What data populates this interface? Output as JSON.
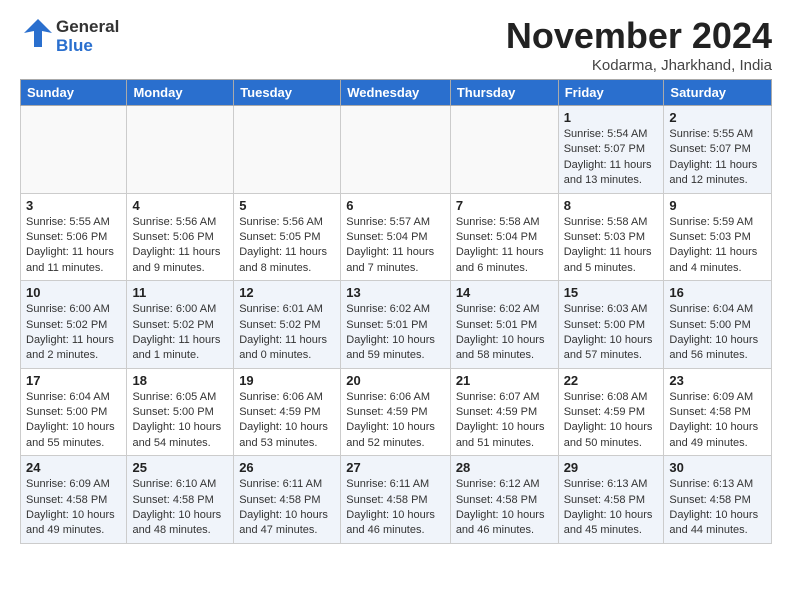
{
  "header": {
    "logo_general": "General",
    "logo_blue": "Blue",
    "month_title": "November 2024",
    "location": "Kodarma, Jharkhand, India"
  },
  "weekdays": [
    "Sunday",
    "Monday",
    "Tuesday",
    "Wednesday",
    "Thursday",
    "Friday",
    "Saturday"
  ],
  "weeks": [
    [
      {
        "day": "",
        "info": ""
      },
      {
        "day": "",
        "info": ""
      },
      {
        "day": "",
        "info": ""
      },
      {
        "day": "",
        "info": ""
      },
      {
        "day": "",
        "info": ""
      },
      {
        "day": "1",
        "info": "Sunrise: 5:54 AM\nSunset: 5:07 PM\nDaylight: 11 hours\nand 13 minutes."
      },
      {
        "day": "2",
        "info": "Sunrise: 5:55 AM\nSunset: 5:07 PM\nDaylight: 11 hours\nand 12 minutes."
      }
    ],
    [
      {
        "day": "3",
        "info": "Sunrise: 5:55 AM\nSunset: 5:06 PM\nDaylight: 11 hours\nand 11 minutes."
      },
      {
        "day": "4",
        "info": "Sunrise: 5:56 AM\nSunset: 5:06 PM\nDaylight: 11 hours\nand 9 minutes."
      },
      {
        "day": "5",
        "info": "Sunrise: 5:56 AM\nSunset: 5:05 PM\nDaylight: 11 hours\nand 8 minutes."
      },
      {
        "day": "6",
        "info": "Sunrise: 5:57 AM\nSunset: 5:04 PM\nDaylight: 11 hours\nand 7 minutes."
      },
      {
        "day": "7",
        "info": "Sunrise: 5:58 AM\nSunset: 5:04 PM\nDaylight: 11 hours\nand 6 minutes."
      },
      {
        "day": "8",
        "info": "Sunrise: 5:58 AM\nSunset: 5:03 PM\nDaylight: 11 hours\nand 5 minutes."
      },
      {
        "day": "9",
        "info": "Sunrise: 5:59 AM\nSunset: 5:03 PM\nDaylight: 11 hours\nand 4 minutes."
      }
    ],
    [
      {
        "day": "10",
        "info": "Sunrise: 6:00 AM\nSunset: 5:02 PM\nDaylight: 11 hours\nand 2 minutes."
      },
      {
        "day": "11",
        "info": "Sunrise: 6:00 AM\nSunset: 5:02 PM\nDaylight: 11 hours\nand 1 minute."
      },
      {
        "day": "12",
        "info": "Sunrise: 6:01 AM\nSunset: 5:02 PM\nDaylight: 11 hours\nand 0 minutes."
      },
      {
        "day": "13",
        "info": "Sunrise: 6:02 AM\nSunset: 5:01 PM\nDaylight: 10 hours\nand 59 minutes."
      },
      {
        "day": "14",
        "info": "Sunrise: 6:02 AM\nSunset: 5:01 PM\nDaylight: 10 hours\nand 58 minutes."
      },
      {
        "day": "15",
        "info": "Sunrise: 6:03 AM\nSunset: 5:00 PM\nDaylight: 10 hours\nand 57 minutes."
      },
      {
        "day": "16",
        "info": "Sunrise: 6:04 AM\nSunset: 5:00 PM\nDaylight: 10 hours\nand 56 minutes."
      }
    ],
    [
      {
        "day": "17",
        "info": "Sunrise: 6:04 AM\nSunset: 5:00 PM\nDaylight: 10 hours\nand 55 minutes."
      },
      {
        "day": "18",
        "info": "Sunrise: 6:05 AM\nSunset: 5:00 PM\nDaylight: 10 hours\nand 54 minutes."
      },
      {
        "day": "19",
        "info": "Sunrise: 6:06 AM\nSunset: 4:59 PM\nDaylight: 10 hours\nand 53 minutes."
      },
      {
        "day": "20",
        "info": "Sunrise: 6:06 AM\nSunset: 4:59 PM\nDaylight: 10 hours\nand 52 minutes."
      },
      {
        "day": "21",
        "info": "Sunrise: 6:07 AM\nSunset: 4:59 PM\nDaylight: 10 hours\nand 51 minutes."
      },
      {
        "day": "22",
        "info": "Sunrise: 6:08 AM\nSunset: 4:59 PM\nDaylight: 10 hours\nand 50 minutes."
      },
      {
        "day": "23",
        "info": "Sunrise: 6:09 AM\nSunset: 4:58 PM\nDaylight: 10 hours\nand 49 minutes."
      }
    ],
    [
      {
        "day": "24",
        "info": "Sunrise: 6:09 AM\nSunset: 4:58 PM\nDaylight: 10 hours\nand 49 minutes."
      },
      {
        "day": "25",
        "info": "Sunrise: 6:10 AM\nSunset: 4:58 PM\nDaylight: 10 hours\nand 48 minutes."
      },
      {
        "day": "26",
        "info": "Sunrise: 6:11 AM\nSunset: 4:58 PM\nDaylight: 10 hours\nand 47 minutes."
      },
      {
        "day": "27",
        "info": "Sunrise: 6:11 AM\nSunset: 4:58 PM\nDaylight: 10 hours\nand 46 minutes."
      },
      {
        "day": "28",
        "info": "Sunrise: 6:12 AM\nSunset: 4:58 PM\nDaylight: 10 hours\nand 46 minutes."
      },
      {
        "day": "29",
        "info": "Sunrise: 6:13 AM\nSunset: 4:58 PM\nDaylight: 10 hours\nand 45 minutes."
      },
      {
        "day": "30",
        "info": "Sunrise: 6:13 AM\nSunset: 4:58 PM\nDaylight: 10 hours\nand 44 minutes."
      }
    ]
  ]
}
